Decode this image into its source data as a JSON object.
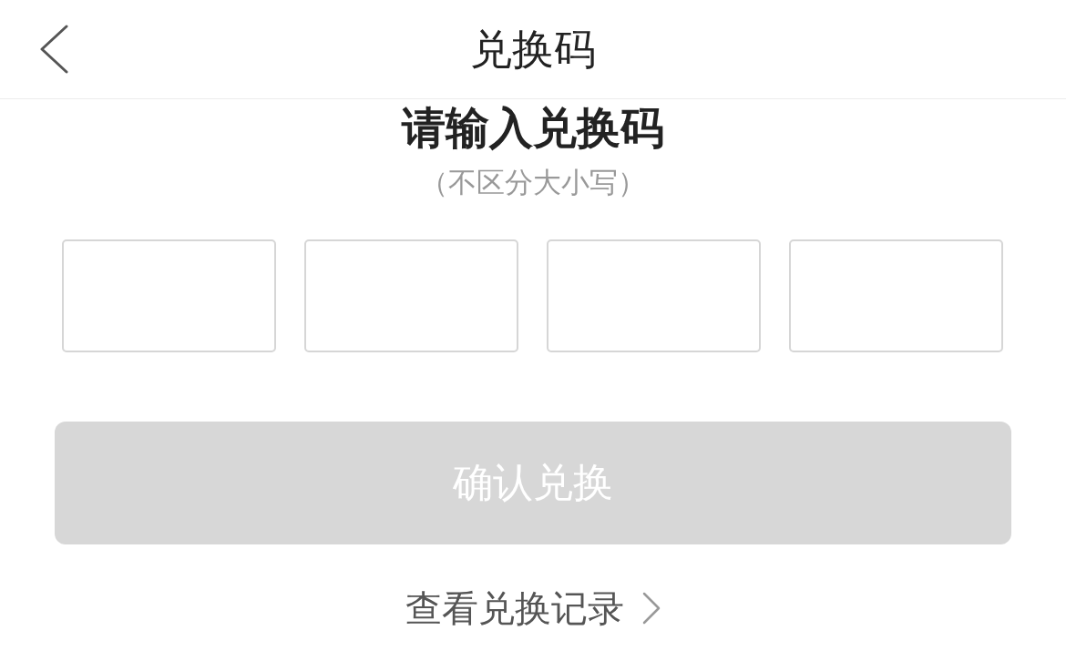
{
  "header": {
    "title": "兑换码"
  },
  "prompt": {
    "title": "请输入兑换码",
    "hint": "（不区分大小写）"
  },
  "code_fields": [
    {
      "focused": false
    },
    {
      "focused": false
    },
    {
      "focused": false
    },
    {
      "focused": false
    }
  ],
  "confirm_button": {
    "label": "确认兑换",
    "disabled": true
  },
  "records_link": {
    "label": "查看兑换记录"
  }
}
